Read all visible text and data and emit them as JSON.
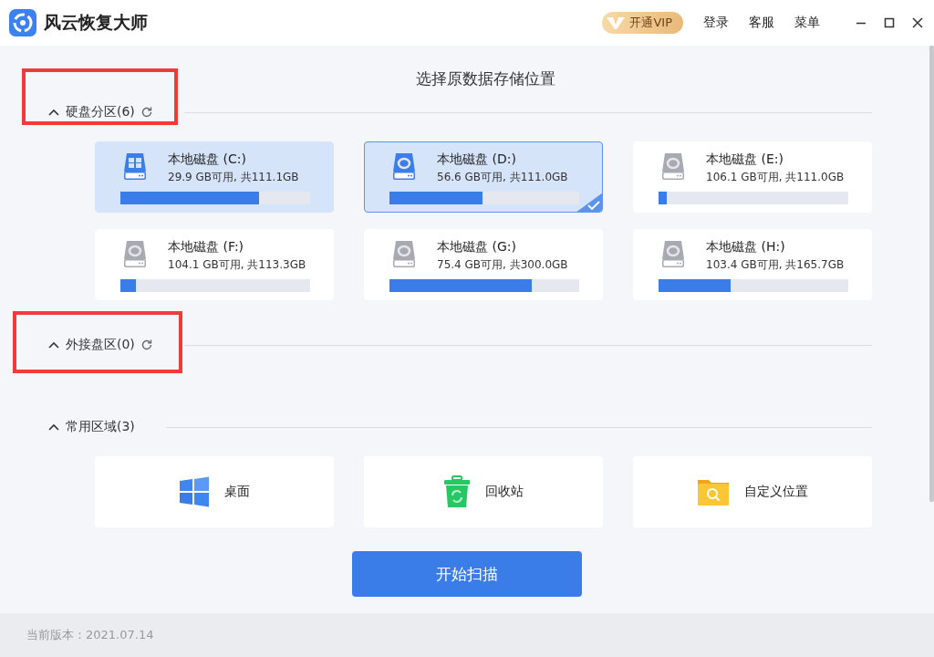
{
  "window": {
    "title": "风云恢复大师",
    "vip_button": "开通VIP",
    "menu": [
      "登录",
      "客服",
      "菜单"
    ]
  },
  "heading": "选择原数据存储位置",
  "sections": [
    {
      "title": "硬盘分区(6)",
      "expanded": true,
      "highlighted": true,
      "refresh": true,
      "kind": "disks",
      "items": [
        {
          "name": "本地磁盘 (C:)",
          "info": "29.9 GB可用, 共111.1GB",
          "level": 0.73,
          "kind": "system",
          "selected": false,
          "hovered": true
        },
        {
          "name": "本地磁盘 (D:)",
          "info": "56.6 GB可用, 共111.0GB",
          "level": 0.49,
          "kind": "data",
          "selected": true,
          "hovered": false
        },
        {
          "name": "本地磁盘 (E:)",
          "info": "106.1 GB可用, 共111.0GB",
          "level": 0.044,
          "kind": "data",
          "selected": false,
          "hovered": false
        },
        {
          "name": "本地磁盘 (F:)",
          "info": "104.1 GB可用, 共113.3GB",
          "level": 0.08,
          "kind": "data",
          "selected": false,
          "hovered": false
        },
        {
          "name": "本地磁盘 (G:)",
          "info": "75.4 GB可用, 共300.0GB",
          "level": 0.75,
          "kind": "data",
          "selected": false,
          "hovered": false
        },
        {
          "name": "本地磁盘 (H:)",
          "info": "103.4 GB可用, 共165.7GB",
          "level": 0.38,
          "kind": "data",
          "selected": false,
          "hovered": false
        }
      ]
    },
    {
      "title": "外接盘区(0)",
      "expanded": true,
      "highlighted": true,
      "refresh": true
    },
    {
      "title": "常用区域(3)",
      "expanded": true,
      "highlighted": false,
      "refresh": false,
      "kind": "places",
      "items": [
        {
          "name": "桌面",
          "kind": "desktop"
        },
        {
          "name": "回收站",
          "kind": "recycle"
        },
        {
          "name": "自定义位置",
          "kind": "folder"
        }
      ]
    }
  ],
  "scan_button": "开始扫描",
  "status_bar": {
    "version": "当前版本：2021.07.14"
  }
}
